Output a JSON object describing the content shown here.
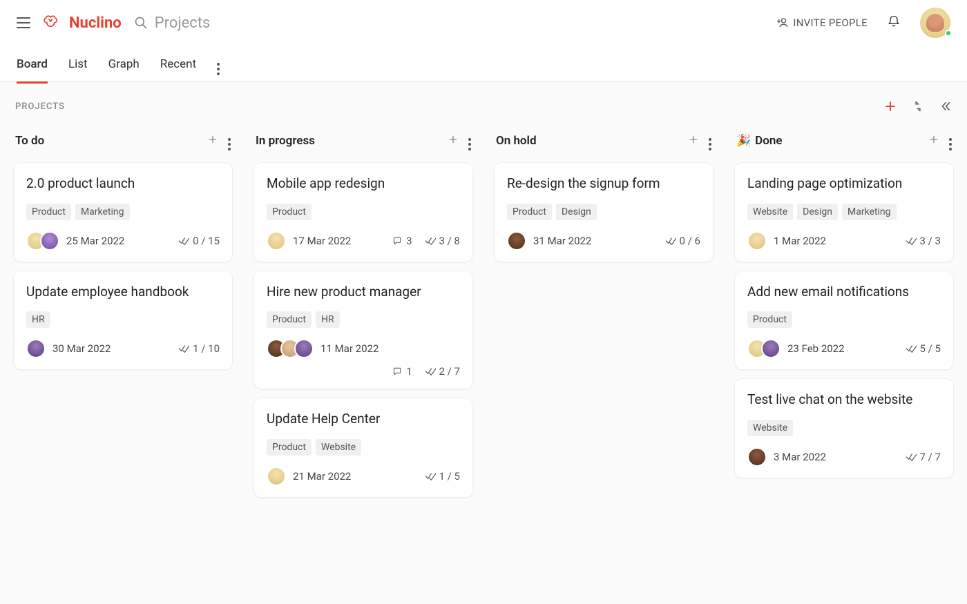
{
  "brand": "Nuclino",
  "search_placeholder": "Projects",
  "invite_label": "INVITE PEOPLE",
  "view_tabs": [
    "Board",
    "List",
    "Graph",
    "Recent"
  ],
  "active_view": "Board",
  "subheader_title": "PROJECTS",
  "columns": [
    {
      "title": "To do",
      "emoji": "",
      "cards": [
        {
          "title": "2.0 product launch",
          "tags": [
            "Product",
            "Marketing"
          ],
          "avatars": [
            "av1",
            "av2"
          ],
          "date": "25 Mar 2022",
          "comments": null,
          "checklist": "0 / 15"
        },
        {
          "title": "Update employee handbook",
          "tags": [
            "HR"
          ],
          "avatars": [
            "av5"
          ],
          "date": "30 Mar 2022",
          "comments": null,
          "checklist": "1 / 10"
        }
      ]
    },
    {
      "title": "In progress",
      "emoji": "",
      "cards": [
        {
          "title": "Mobile app redesign",
          "tags": [
            "Product"
          ],
          "avatars": [
            "av1"
          ],
          "date": "17 Mar 2022",
          "comments": "3",
          "checklist": "3 / 8"
        },
        {
          "title": "Hire new product manager",
          "tags": [
            "Product",
            "HR"
          ],
          "avatars": [
            "av3",
            "av4",
            "av5"
          ],
          "date": "11 Mar 2022",
          "comments": "1",
          "checklist": "2 / 7",
          "two_row_foot": true
        },
        {
          "title": "Update Help Center",
          "tags": [
            "Product",
            "Website"
          ],
          "avatars": [
            "av1"
          ],
          "date": "21 Mar 2022",
          "comments": null,
          "checklist": "1 / 5"
        }
      ]
    },
    {
      "title": "On hold",
      "emoji": "",
      "cards": [
        {
          "title": "Re-design the signup form",
          "tags": [
            "Product",
            "Design"
          ],
          "avatars": [
            "av3"
          ],
          "date": "31 Mar 2022",
          "comments": null,
          "checklist": "0 / 6"
        }
      ]
    },
    {
      "title": "Done",
      "emoji": "🎉",
      "cards": [
        {
          "title": "Landing page optimization",
          "tags": [
            "Website",
            "Design",
            "Marketing"
          ],
          "avatars": [
            "av1"
          ],
          "date": "1 Mar 2022",
          "comments": null,
          "checklist": "3 / 3"
        },
        {
          "title": "Add new email notifications",
          "tags": [
            "Product"
          ],
          "avatars": [
            "av1",
            "av5"
          ],
          "date": "23 Feb 2022",
          "comments": null,
          "checklist": "5 / 5"
        },
        {
          "title": "Test live chat on the website",
          "tags": [
            "Website"
          ],
          "avatars": [
            "av3"
          ],
          "date": "3 Mar 2022",
          "comments": null,
          "checklist": "7 / 7"
        }
      ]
    }
  ]
}
